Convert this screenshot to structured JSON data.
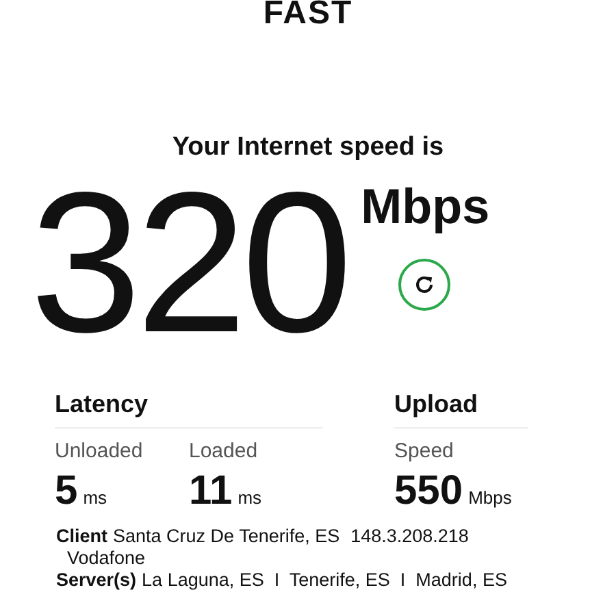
{
  "logo": "FAST",
  "headline": "Your Internet speed is",
  "speed": {
    "value": "320",
    "unit": "Mbps"
  },
  "latency": {
    "title": "Latency",
    "metrics": [
      {
        "label": "Unloaded",
        "value": "5",
        "unit": "ms"
      },
      {
        "label": "Loaded",
        "value": "11",
        "unit": "ms"
      }
    ]
  },
  "upload": {
    "title": "Upload",
    "metrics": [
      {
        "label": "Speed",
        "value": "550",
        "unit": "Mbps"
      }
    ]
  },
  "client": {
    "label": "Client",
    "location": "Santa Cruz De Tenerife, ES",
    "ip": "148.3.208.218",
    "isp": "Vodafone"
  },
  "servers": {
    "label": "Server(s)",
    "list": "La Laguna, ES  I  Tenerife, ES  I  Madrid, ES"
  }
}
